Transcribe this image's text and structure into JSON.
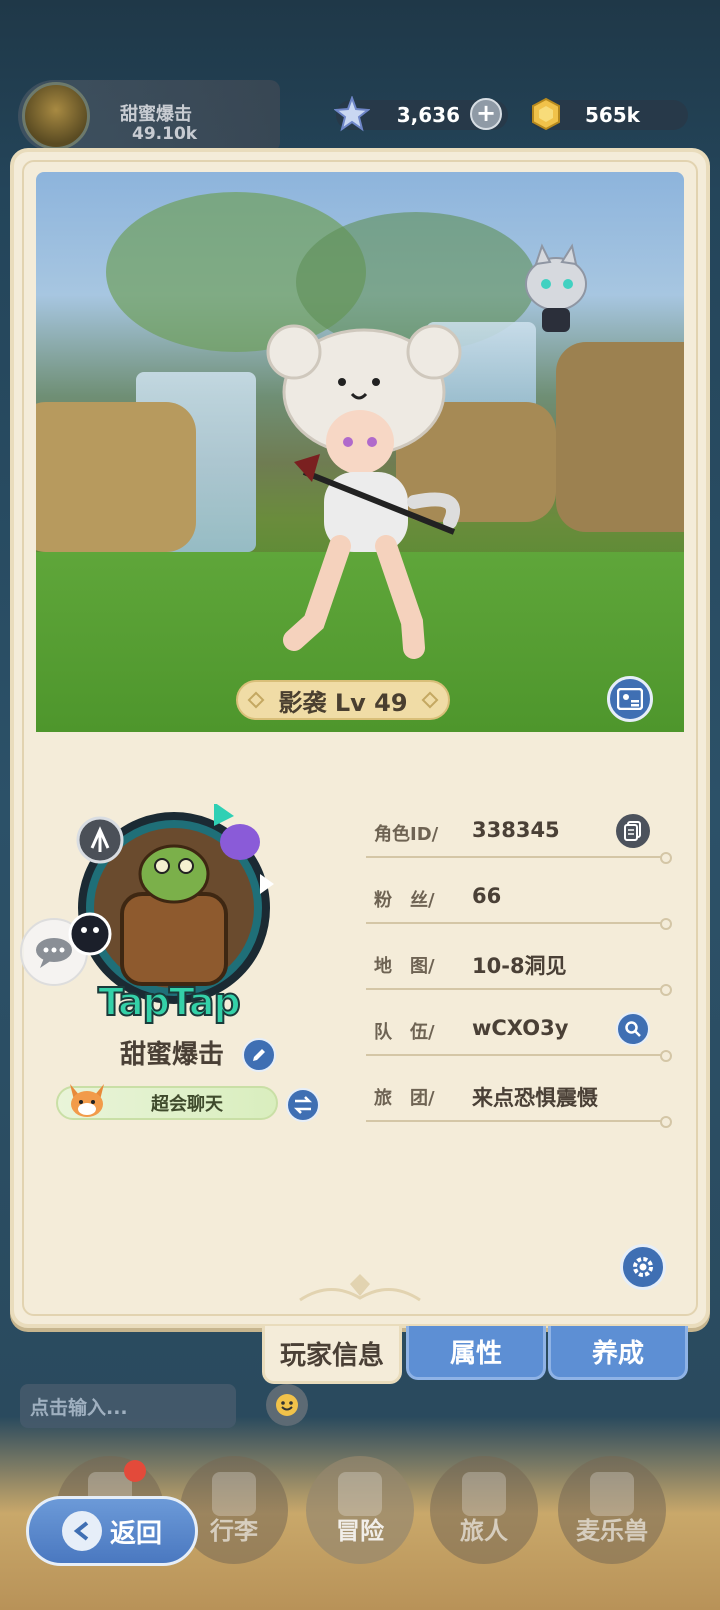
{
  "header": {
    "player_chip_name": "甜蜜爆击",
    "player_chip_power": "49.10k",
    "gems": "3,636",
    "gold": "565k"
  },
  "character": {
    "class_level": "影袭 Lv 49"
  },
  "profile": {
    "logo_text": "TapTap",
    "name": "甜蜜爆击",
    "title": "超会聊天"
  },
  "info": {
    "rows": [
      {
        "label": "角色ID/",
        "value": "338345"
      },
      {
        "label": "粉　丝/",
        "value": "66"
      },
      {
        "label": "地　图/",
        "value": "10-8洞见"
      },
      {
        "label": "队　伍/",
        "value": "wCXO3y"
      },
      {
        "label": "旅　团/",
        "value": "来点恐惧震慑"
      }
    ]
  },
  "tabs": {
    "player_info": "玩家信息",
    "attributes": "属性",
    "training": "养成"
  },
  "chat": {
    "placeholder": "点击输入..."
  },
  "nav": {
    "back": "返回",
    "items": [
      "行李",
      "冒险",
      "旅人",
      "麦乐兽"
    ]
  },
  "colors": {
    "accent_blue": "#3f6fb3",
    "tab_blue": "#5d8fd4",
    "card_bg": "#f4ecd9",
    "logo_green": "#34d1a8"
  },
  "icons": {
    "gem": "star-crystal-icon",
    "gold": "gold-coin-icon",
    "photo": "photo-card-icon",
    "edit": "pencil-icon",
    "swap": "swap-arrows-icon",
    "copy": "copy-icon",
    "search": "search-icon",
    "settings": "gear-icon",
    "chat": "chat-bubble-icon",
    "emoji": "smile-icon"
  }
}
